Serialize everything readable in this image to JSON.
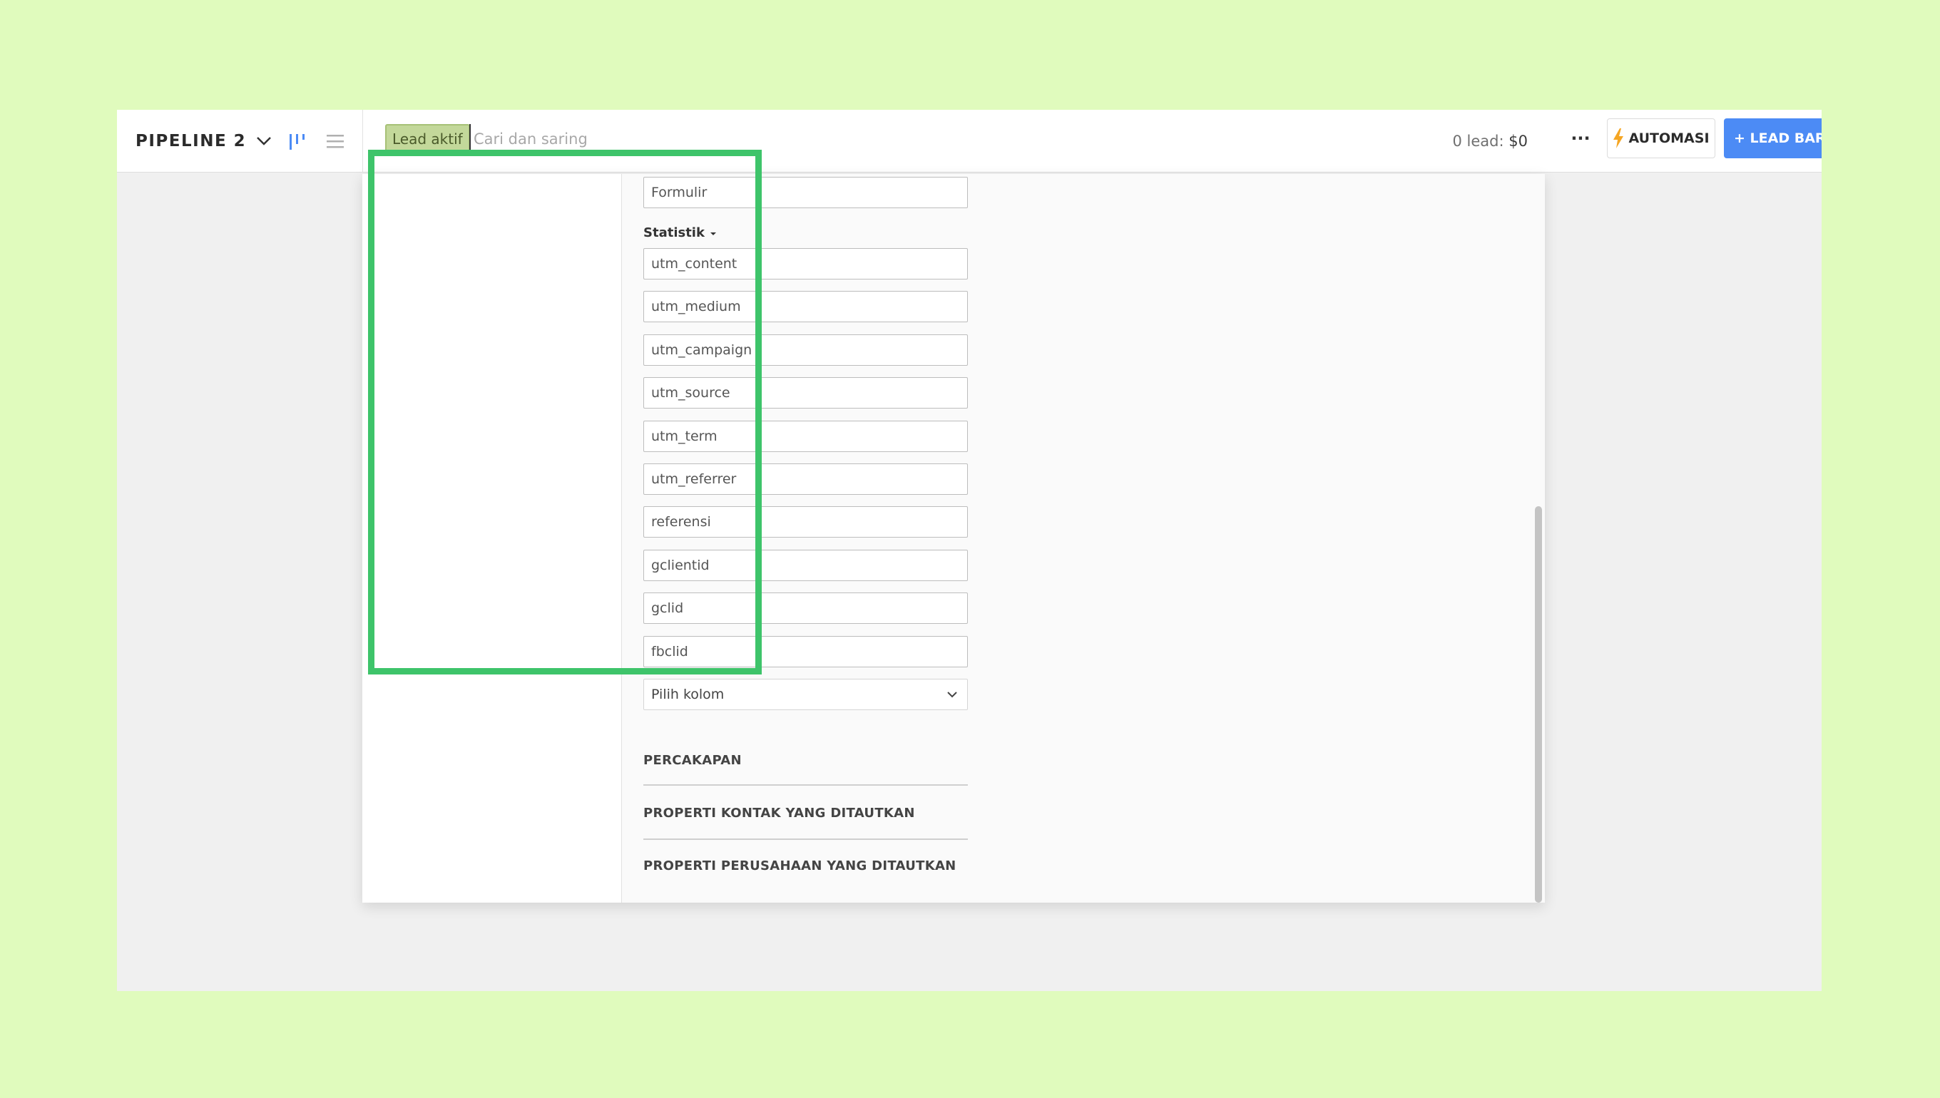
{
  "header": {
    "pipeline_name": "PIPELINE 2",
    "filter_chip": "Lead aktif",
    "search_placeholder": "Cari dan saring",
    "lead_count": "0 lead:",
    "lead_value": "$0",
    "more_label": "···",
    "automation_label": "AUTOMASI",
    "new_lead_label": "+ LEAD BARU"
  },
  "form": {
    "top_field_placeholder": "Formulir",
    "statistics_label": "Statistik",
    "statistics_fields": [
      "utm_content",
      "utm_medium",
      "utm_campaign",
      "utm_source",
      "utm_term",
      "utm_referrer",
      "referensi",
      "gclientid",
      "gclid",
      "fbclid"
    ],
    "column_select": "Pilih kolom"
  },
  "sections": [
    "PERCAKAPAN",
    "PROPERTI KONTAK YANG DITAUTKAN",
    "PROPERTI PERUSAHAAN YANG DITAUTKAN"
  ],
  "colors": {
    "background": "#e0fbbd",
    "highlight": "#3ec46a",
    "primary_button": "#4c8bf5",
    "automation_bolt": "#f5a623",
    "view_toggle_active": "#4c8bf5"
  },
  "icons": {
    "pipeline_dropdown": "chevron-down-icon",
    "view_kanban": "kanban-view-icon",
    "view_list": "list-view-icon",
    "automation": "lightning-bolt-icon",
    "select": "chevron-down-icon",
    "statistics_toggle": "caret-down-icon"
  }
}
